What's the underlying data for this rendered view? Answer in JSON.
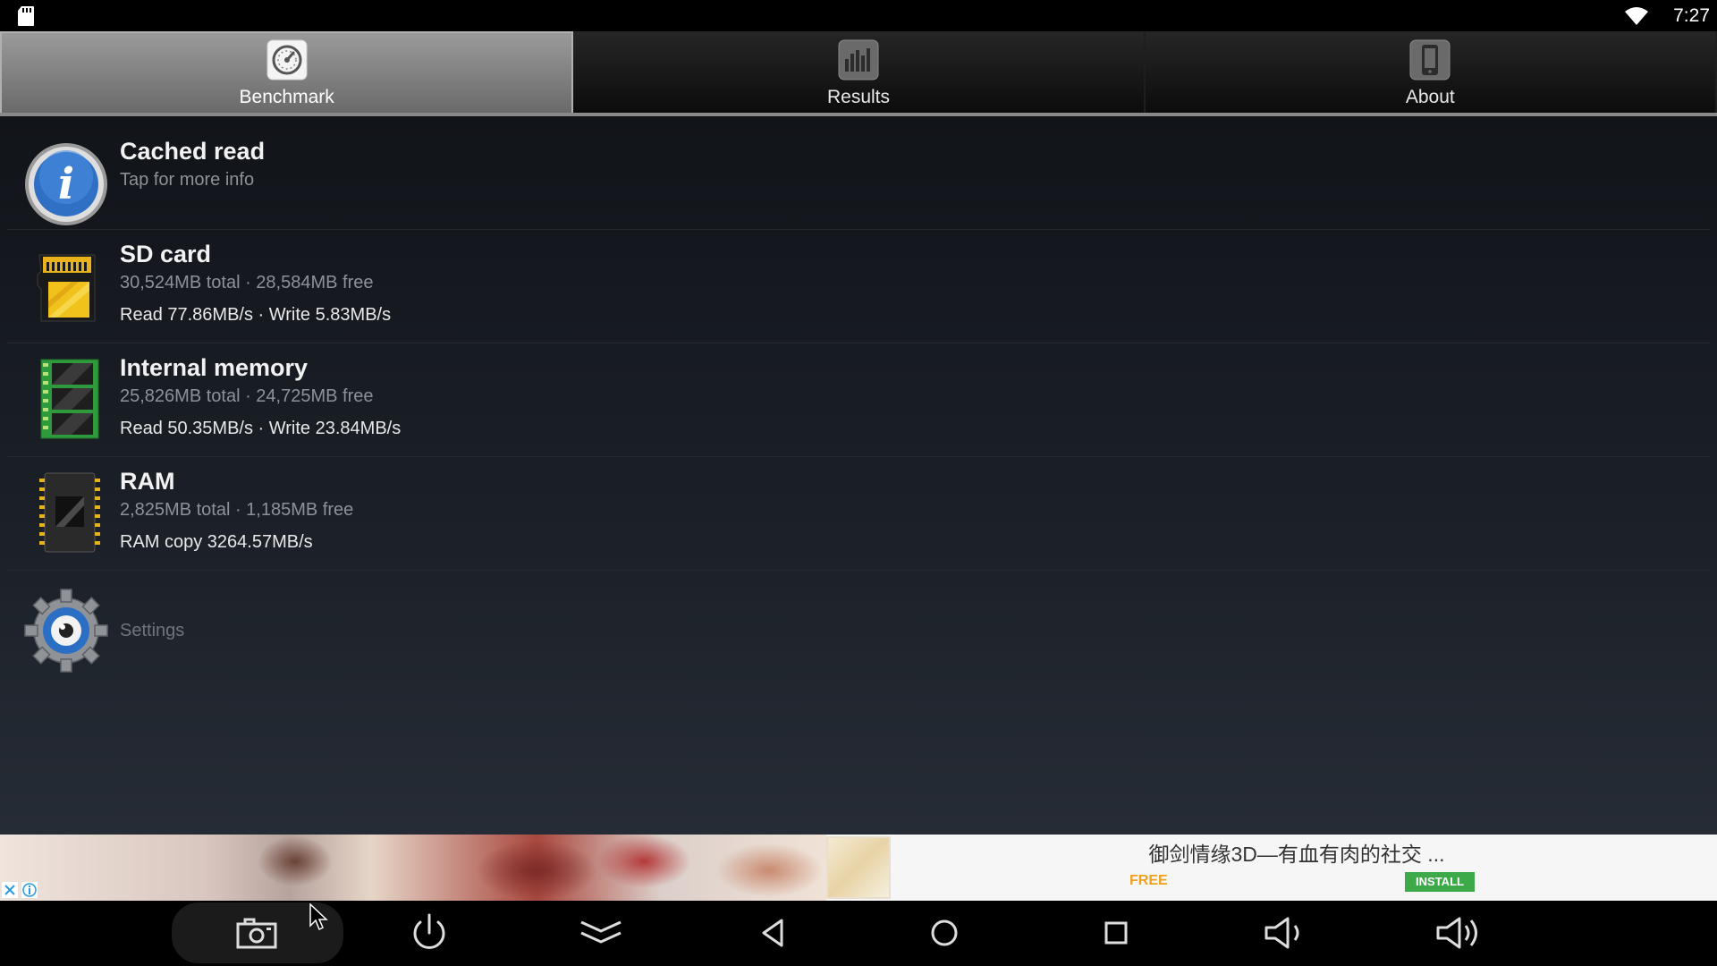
{
  "status_bar": {
    "time": "7:27",
    "icons": [
      "sd-card-icon",
      "wifi-icon"
    ]
  },
  "tabs": [
    {
      "label": "Benchmark",
      "icon": "speedometer-icon",
      "active": true
    },
    {
      "label": "Results",
      "icon": "bar-chart-icon",
      "active": false
    },
    {
      "label": "About",
      "icon": "phone-icon",
      "active": false
    }
  ],
  "list": {
    "info": {
      "title": "Cached read",
      "subtitle": "Tap for more info",
      "icon": "info-icon"
    },
    "sd_card": {
      "title": "SD card",
      "subtitle": "30,524MB total · 28,584MB free",
      "speed": "Read 77.86MB/s · Write 5.83MB/s",
      "icon": "sd-card-icon"
    },
    "internal_memory": {
      "title": "Internal memory",
      "subtitle": "25,826MB total · 24,725MB free",
      "speed": "Read 50.35MB/s · Write 23.84MB/s",
      "icon": "memory-chip-icon"
    },
    "ram": {
      "title": "RAM",
      "subtitle": "2,825MB total · 1,185MB free",
      "speed": "RAM copy 3264.57MB/s",
      "icon": "ram-chip-icon"
    },
    "settings": {
      "label": "Settings",
      "icon": "gear-icon"
    }
  },
  "ad": {
    "title": "御剑情缘3D—有血有肉的社交 ...",
    "price": "FREE",
    "cta": "INSTALL",
    "colors": {
      "price": "#f0a11b",
      "cta": "#3daa4a"
    }
  },
  "nav_bar": {
    "buttons": [
      "screenshot-icon",
      "power-icon",
      "expand-icon",
      "back-icon",
      "home-icon",
      "recents-icon",
      "volume-down-icon",
      "volume-up-icon"
    ]
  },
  "colors": {
    "background": "#1c2129",
    "tab_active": "#8a8a8a",
    "title_text": "#f2f2f2",
    "sub_text": "#8d9298"
  }
}
